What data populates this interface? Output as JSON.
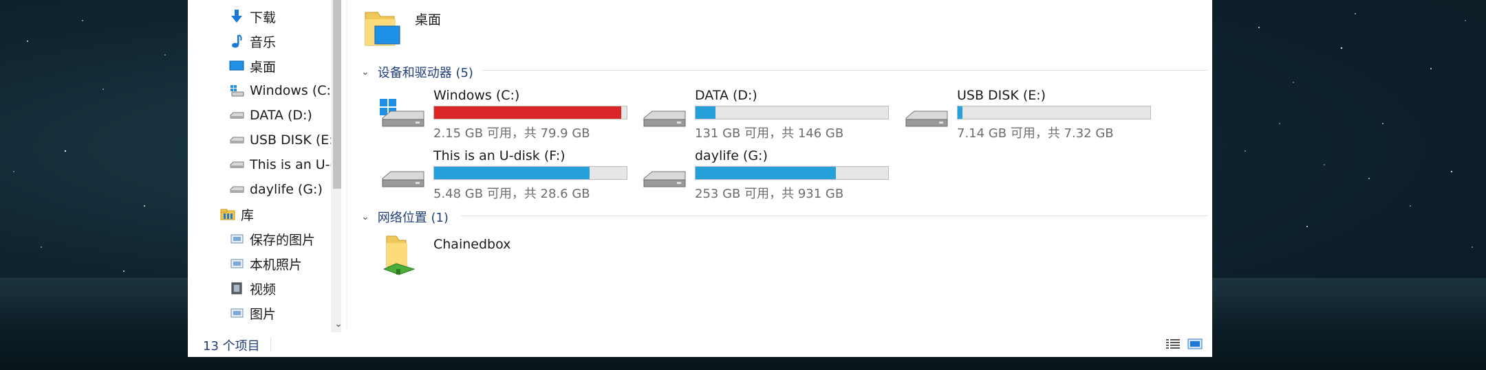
{
  "nav": {
    "items": [
      {
        "label": "下载",
        "icon": "download-arrow-icon"
      },
      {
        "label": "音乐",
        "icon": "music-note-icon"
      },
      {
        "label": "桌面",
        "icon": "desktop-icon"
      },
      {
        "label": "Windows (C:)",
        "icon": "windows-drive-icon"
      },
      {
        "label": "DATA (D:)",
        "icon": "drive-icon"
      },
      {
        "label": "USB DISK (E:)",
        "icon": "drive-icon"
      },
      {
        "label": "This is an U-disk (F:)",
        "icon": "drive-icon"
      },
      {
        "label": "daylife (G:)",
        "icon": "drive-icon"
      },
      {
        "label": "库",
        "icon": "library-icon"
      },
      {
        "label": "保存的图片",
        "icon": "library-pictures-icon"
      },
      {
        "label": "本机照片",
        "icon": "library-pictures-icon"
      },
      {
        "label": "视频",
        "icon": "library-video-icon"
      },
      {
        "label": "图片",
        "icon": "library-pictures-icon"
      }
    ]
  },
  "folders": {
    "desktop_label": "桌面"
  },
  "groups": {
    "devices_header": "设备和驱动器 (5)",
    "network_header": "网络位置 (1)"
  },
  "drives": [
    {
      "name": "Windows (C:)",
      "free": "2.15 GB 可用，共 79.9 GB",
      "used_fraction": 0.973,
      "color": "#da2626",
      "system": true
    },
    {
      "name": "DATA (D:)",
      "free": "131 GB 可用，共 146 GB",
      "used_fraction": 0.103,
      "color": "#26a0da",
      "system": false
    },
    {
      "name": "USB DISK (E:)",
      "free": "7.14 GB 可用，共 7.32 GB",
      "used_fraction": 0.025,
      "color": "#26a0da",
      "system": false
    },
    {
      "name": "This is an U-disk (F:)",
      "free": "5.48 GB 可用，共 28.6 GB",
      "used_fraction": 0.808,
      "color": "#26a0da",
      "system": false
    },
    {
      "name": "daylife (G:)",
      "free": "253 GB 可用，共 931 GB",
      "used_fraction": 0.728,
      "color": "#26a0da",
      "system": false
    }
  ],
  "network": {
    "item_label": "Chainedbox"
  },
  "status": {
    "count": "13 个项目"
  },
  "colors": {
    "accent": "#26a0da",
    "warning": "#da2626",
    "link": "#1f3d7a"
  }
}
